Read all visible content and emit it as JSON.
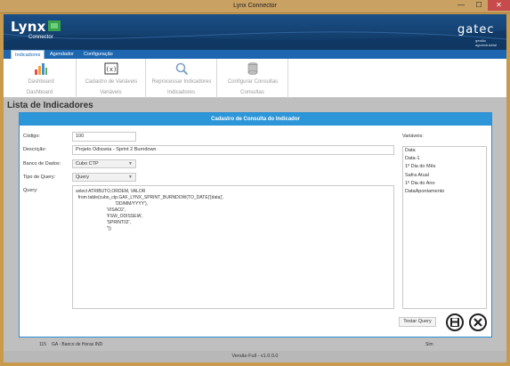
{
  "window": {
    "title": "Lynx Connector",
    "minimize": "—",
    "maximize": "☐",
    "close": "✕"
  },
  "header": {
    "logo": "Lynx",
    "logo_sub": "Connector",
    "brand": "gatec",
    "brand_sub": "gestão agroindustrial"
  },
  "ribbon": {
    "tabs": [
      {
        "label": "Indicadores"
      },
      {
        "label": "Agendador"
      },
      {
        "label": "Configuração"
      }
    ],
    "groups": [
      {
        "label": "Dashboard",
        "button": "Dashboard",
        "icon": "chart-icon"
      },
      {
        "label": "Variáveis",
        "button": "Cadastro de Variáveis",
        "icon": "variable-icon"
      },
      {
        "label": "Indicadores",
        "button": "Reprocessar Indicadores",
        "icon": "gear-search-icon"
      },
      {
        "label": "Consultas",
        "button": "Configurar Consultas",
        "icon": "database-icon"
      }
    ]
  },
  "page": {
    "title": "Lista de Indicadores",
    "row": {
      "id": "115",
      "name": "GA - Banco de Horas IND",
      "flag": "Sim"
    }
  },
  "modal": {
    "title": "Cadastro de Consulta do Indicador",
    "codigo_label": "Código:",
    "codigo_value": "100",
    "descricao_label": "Descrição:",
    "descricao_value": "Projeto Odisseia - Sprint 2 Burndown",
    "banco_label": "Banco de Dados:",
    "banco_value": "Cubo CTP",
    "tipo_label": "Tipo de Query:",
    "tipo_value": "Query",
    "query_label": "Query:",
    "query_text": "select ATRIBUTO,ORDEM, VALOR\n  from table(cubo_ctp.GAF_LYNX_SPRINT_BURNDOW(TO_DATE('[data]',\n                                'DD/MM/YYYY'),\n                         'VISAO2',\n                         'FSW_ODISSEIA',\n                         'SPRINT02',\n                         ''))",
    "variaveis_label": "Variáveis:",
    "variables": [
      "Data",
      "Data-1",
      "1º Dia do Mês",
      "Safra Atual",
      "1º Dia do Ano",
      "DataApontamento"
    ],
    "test_button": "Testar Query"
  },
  "status": {
    "version": "Versão Full - v1.0.0.0"
  }
}
